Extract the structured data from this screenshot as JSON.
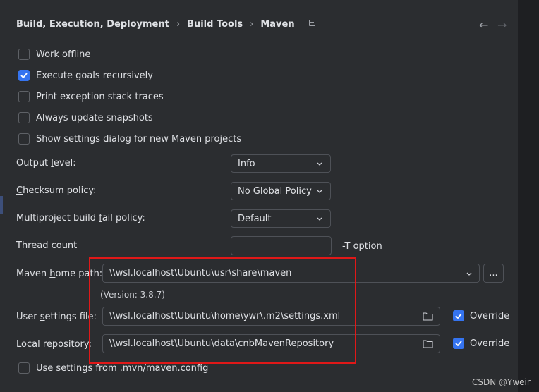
{
  "breadcrumb": {
    "item1": "Build, Execution, Deployment",
    "item2": "Build Tools",
    "item3": "Maven",
    "sep": "›"
  },
  "checkboxes": [
    {
      "label": "Work offline",
      "checked": false
    },
    {
      "label": "Execute goals recursively",
      "checked": true
    },
    {
      "label": "Print exception stack traces",
      "checked": false
    },
    {
      "label": "Always update snapshots",
      "checked": false
    },
    {
      "label": "Show settings dialog for new Maven projects",
      "checked": false
    }
  ],
  "output_level": {
    "label_pre": "Output ",
    "label_ul": "l",
    "label_post": "evel:",
    "value": "Info"
  },
  "checksum_policy": {
    "label_ul": "C",
    "label_post": "hecksum policy:",
    "value": "No Global Policy"
  },
  "fail_policy": {
    "label_pre": "Multiproject build ",
    "label_ul": "f",
    "label_post": "ail policy:",
    "value": "Default"
  },
  "thread_count": {
    "label": "Thread count",
    "value": "",
    "suffix": "-T option"
  },
  "maven_home": {
    "label_pre": "Maven ",
    "label_ul": "h",
    "label_post": "ome path:",
    "value": "\\\\wsl.localhost\\Ubuntu\\usr\\share\\maven",
    "version": "(Version: 3.8.7)",
    "browse": "..."
  },
  "user_settings": {
    "label_pre": "User ",
    "label_ul": "s",
    "label_post": "ettings file:",
    "value": "\\\\wsl.localhost\\Ubuntu\\home\\ywr\\.m2\\settings.xml",
    "override_label": "Override",
    "override_checked": true
  },
  "local_repo": {
    "label_pre": "Local ",
    "label_ul": "r",
    "label_post": "epository:",
    "value": "\\\\wsl.localhost\\Ubuntu\\data\\cnbMavenRepository",
    "override_label": "Override",
    "override_checked": true
  },
  "mvn_config": {
    "label": "Use settings from .mvn/maven.config",
    "checked": false
  },
  "watermark": "CSDN @Yweir",
  "colors": {
    "accent": "#3574f0",
    "annotation": "#e01818",
    "background": "#2b2d30"
  }
}
